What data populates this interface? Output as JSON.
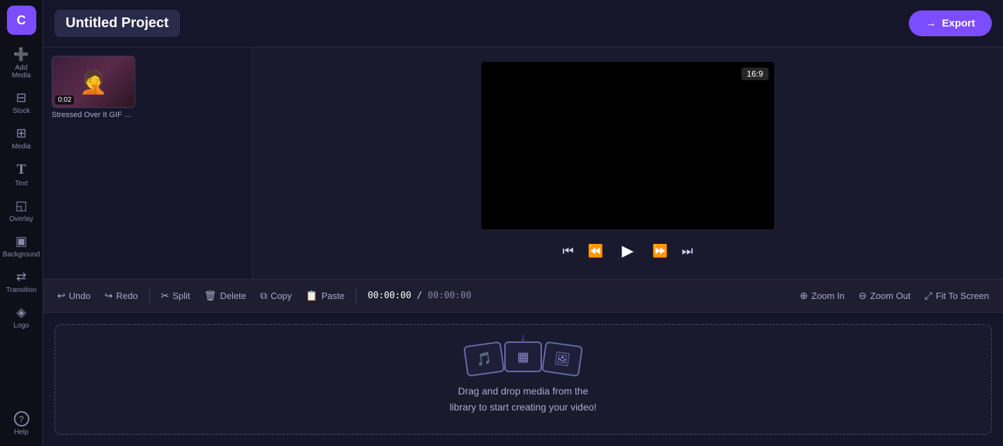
{
  "app": {
    "logo_letter": "C",
    "project_title": "Untitled Project",
    "aspect_ratio": "16:9"
  },
  "sidebar": {
    "items": [
      {
        "id": "add-media",
        "label": "Add Media",
        "icon": "➕"
      },
      {
        "id": "stock",
        "label": "Stock",
        "icon": "◧"
      },
      {
        "id": "media",
        "label": "Media",
        "icon": "▦"
      },
      {
        "id": "text",
        "label": "Text",
        "icon": "T"
      },
      {
        "id": "overlay",
        "label": "Overlay",
        "icon": "◱"
      },
      {
        "id": "background",
        "label": "Background",
        "icon": "▣"
      },
      {
        "id": "transition",
        "label": "Transition",
        "icon": "⇄"
      },
      {
        "id": "logo",
        "label": "Logo",
        "icon": "◈"
      }
    ],
    "help_label": "Help",
    "help_icon": "?"
  },
  "media_panel": {
    "item": {
      "duration": "0:02",
      "label": "Stressed Over It GIF by ..."
    }
  },
  "toolbar": {
    "undo_label": "Undo",
    "redo_label": "Redo",
    "split_label": "Split",
    "delete_label": "Delete",
    "copy_label": "Copy",
    "paste_label": "Paste",
    "zoom_in_label": "Zoom In",
    "zoom_out_label": "Zoom Out",
    "fit_to_screen_label": "Fit To Screen"
  },
  "timecode": {
    "current": "00:00:00",
    "total": "00:00:00"
  },
  "export": {
    "label": "Export",
    "icon": "→"
  },
  "timeline": {
    "empty_text_line1": "Drag and drop media from the",
    "empty_text_line2": "library to start creating your video!"
  }
}
